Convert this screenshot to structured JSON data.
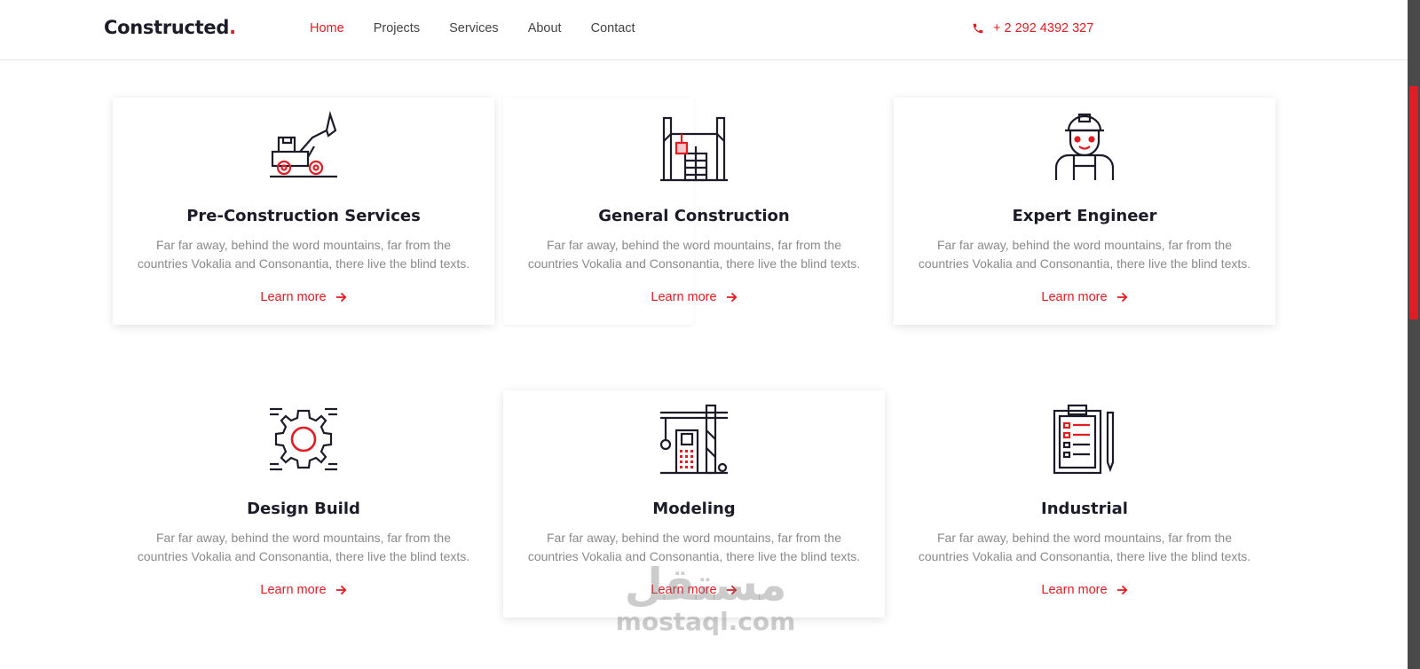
{
  "header": {
    "logo_text": "Constructed",
    "logo_dot": ".",
    "nav": [
      {
        "label": "Home",
        "active": true
      },
      {
        "label": "Projects",
        "active": false
      },
      {
        "label": "Services",
        "active": false
      },
      {
        "label": "About",
        "active": false
      },
      {
        "label": "Contact",
        "active": false
      }
    ],
    "phone": "+ 2 292 4392 327"
  },
  "services": [
    {
      "icon": "excavator-icon",
      "title": "Pre-Construction Services",
      "desc": "Far far away, behind the word mountains, far from the countries Vokalia and Consonantia, there live the blind texts.",
      "link": "Learn more"
    },
    {
      "icon": "crane-building-icon",
      "title": "General Construction",
      "desc": "Far far away, behind the word mountains, far from the countries Vokalia and Consonantia, there live the blind texts.",
      "link": "Learn more"
    },
    {
      "icon": "engineer-icon",
      "title": "Expert Engineer",
      "desc": "Far far away, behind the word mountains, far from the countries Vokalia and Consonantia, there live the blind texts.",
      "link": "Learn more"
    },
    {
      "icon": "gear-icon",
      "title": "Design Build",
      "desc": "Far far away, behind the word mountains, far from the countries Vokalia and Consonantia, there live the blind texts.",
      "link": "Learn more"
    },
    {
      "icon": "tower-crane-icon",
      "title": "Modeling",
      "desc": "Far far away, behind the word mountains, far from the countries Vokalia and Consonantia, there live the blind texts.",
      "link": "Learn more"
    },
    {
      "icon": "clipboard-icon",
      "title": "Industrial",
      "desc": "Far far away, behind the word mountains, far from the countries Vokalia and Consonantia, there live the blind texts.",
      "link": "Learn more"
    }
  ],
  "watermark": {
    "arabic": "مستقل",
    "latin": "mostaql.com"
  },
  "colors": {
    "accent": "#e31b23",
    "dark": "#1c1c28",
    "muted": "#8a8a8a"
  }
}
